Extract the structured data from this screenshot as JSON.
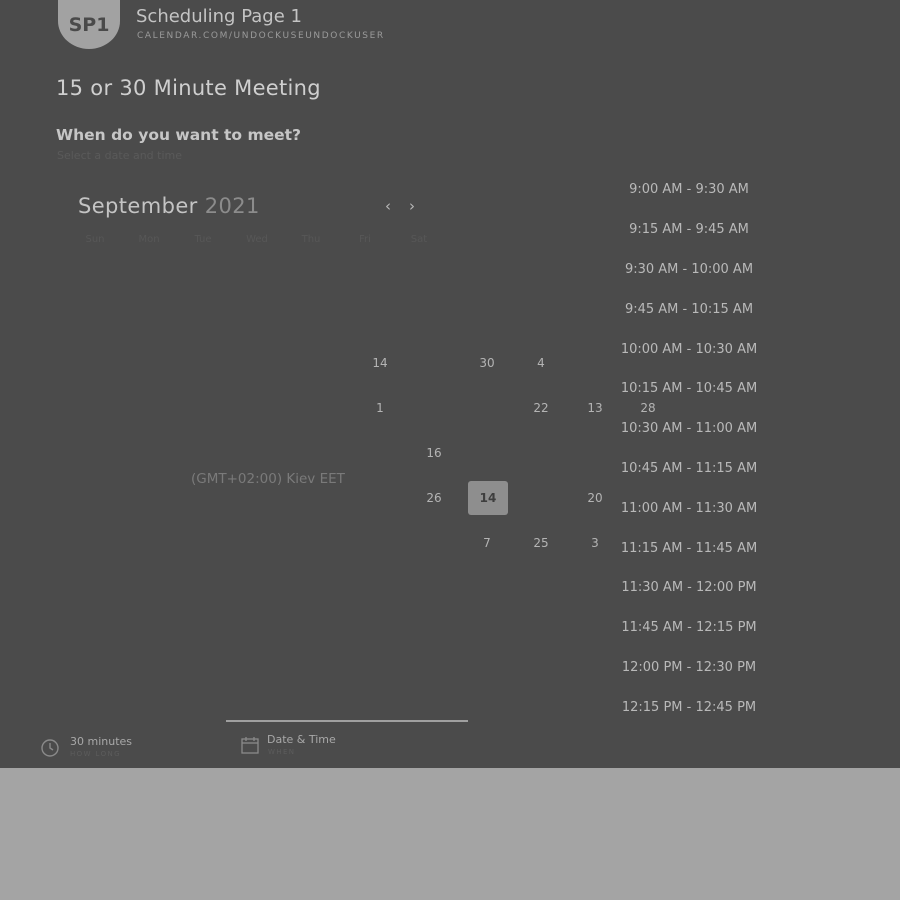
{
  "header": {
    "avatar": "SP1",
    "title": "Scheduling Page 1",
    "url": "CALENDAR.COM/UNDOCKUSEUNDOCKUSER"
  },
  "meeting": {
    "title": "15 or 30 Minute Meeting",
    "question": "When do you want to meet?",
    "subtitle": "Select a date and time"
  },
  "calendar": {
    "month": "September",
    "year": "2021",
    "weekdays": [
      "Sun",
      "Mon",
      "Tue",
      "Wed",
      "Thu",
      "Fri",
      "Sat"
    ],
    "days": [
      {
        "label": "14",
        "state": "normal"
      },
      {
        "label": "30",
        "state": "normal"
      },
      {
        "label": "4",
        "state": "normal"
      },
      {
        "label": "1",
        "state": "normal"
      },
      {
        "label": "22",
        "state": "normal"
      },
      {
        "label": "13",
        "state": "normal"
      },
      {
        "label": "28",
        "state": "normal"
      },
      {
        "label": "16",
        "state": "normal"
      },
      {
        "label": "26",
        "state": "normal"
      },
      {
        "label": "14",
        "state": "selected"
      },
      {
        "label": "20",
        "state": "normal"
      },
      {
        "label": "7",
        "state": "normal"
      },
      {
        "label": "25",
        "state": "normal"
      },
      {
        "label": "3",
        "state": "normal"
      }
    ]
  },
  "timezone": "(GMT+02:00) Kiev EET",
  "slots": [
    "9:00 AM - 9:30 AM",
    "9:15 AM - 9:45 AM",
    "9:30 AM - 10:00 AM",
    "9:45 AM - 10:15 AM",
    "10:00 AM - 10:30 AM",
    "10:15 AM - 10:45 AM",
    "10:30 AM - 11:00 AM",
    "10:45 AM - 11:15 AM",
    "11:00 AM - 11:30 AM",
    "11:15 AM - 11:45 AM",
    "11:30 AM - 12:00 PM",
    "11:45 AM - 12:15 PM",
    "12:00 PM - 12:30 PM",
    "12:15 PM - 12:45 PM"
  ],
  "steps": [
    {
      "label": "30 minutes",
      "sub": "HOW LONG"
    },
    {
      "label": "Date & Time",
      "sub": "WHEN"
    }
  ]
}
